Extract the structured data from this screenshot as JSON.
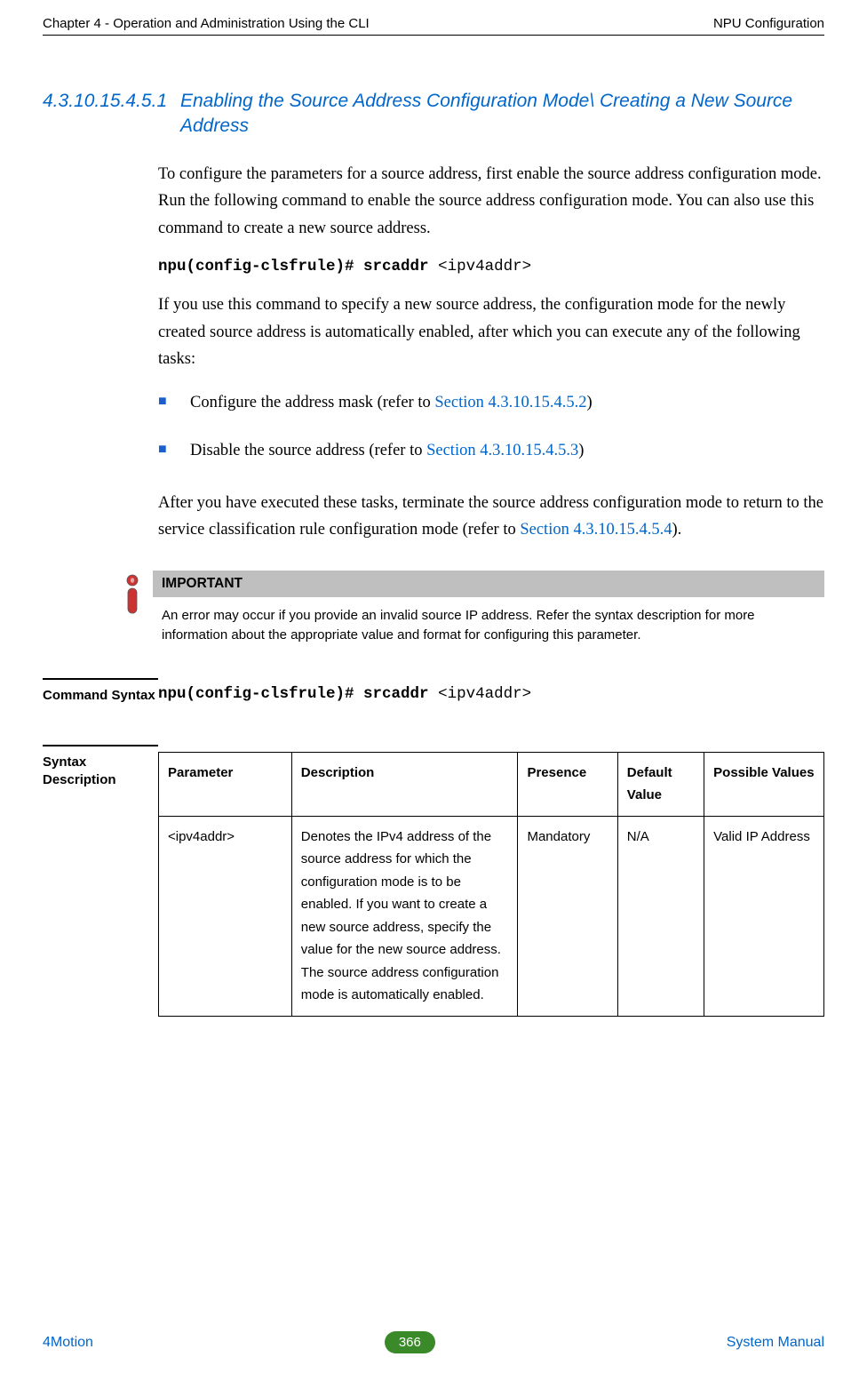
{
  "header": {
    "left": "Chapter 4 - Operation and Administration Using the CLI",
    "right": "NPU Configuration"
  },
  "section": {
    "number": "4.3.10.15.4.5.1",
    "title": "Enabling the Source Address Configuration Mode\\ Creating a New Source Address"
  },
  "para1": "To configure the parameters for a source address, first enable the source address configuration mode. Run the following command to enable the source address configuration mode. You can also use this command to create a new source address.",
  "cmd1_prefix": "npu(config-clsfrule)# srcaddr ",
  "cmd1_arg": "<ipv4addr>",
  "para2": "If you use this command to specify a new source address, the configuration mode for the newly created source address is automatically enabled, after which you can execute any of the following tasks:",
  "bullets": [
    {
      "pre": "Configure the address mask (refer to ",
      "link": "Section 4.3.10.15.4.5.2",
      "post": ")"
    },
    {
      "pre": "Disable the source address (refer to ",
      "link": "Section 4.3.10.15.4.5.3",
      "post": ")"
    }
  ],
  "para3_pre": "After you have executed these tasks, terminate the source address configuration mode to return to the service classification rule configuration mode (refer to ",
  "para3_link": "Section 4.3.10.15.4.5.4",
  "para3_post": ").",
  "note": {
    "title": "IMPORTANT",
    "text": "An error may occur if you provide an invalid source IP address. Refer the syntax description for more information about the appropriate value and format for configuring this parameter."
  },
  "command_syntax": {
    "label": "Command Syntax",
    "prefix": "npu(config-clsfrule)# srcaddr ",
    "arg": "<ipv4addr>"
  },
  "syntax_desc": {
    "label": "Syntax Description",
    "headers": {
      "parameter": "Parameter",
      "description": "Description",
      "presence": "Presence",
      "default": "Default Value",
      "possible": "Possible Values"
    },
    "row": {
      "parameter": "<ipv4addr>",
      "description": "Denotes the IPv4 address of the source address for which the configuration mode is to be enabled. If you want to create a new source address, specify the value for the new source address. The source address configuration mode is automatically enabled.",
      "presence": "Mandatory",
      "default": "N/A",
      "possible": "Valid IP Address"
    }
  },
  "footer": {
    "left": "4Motion",
    "page": "366",
    "right": "System Manual"
  }
}
